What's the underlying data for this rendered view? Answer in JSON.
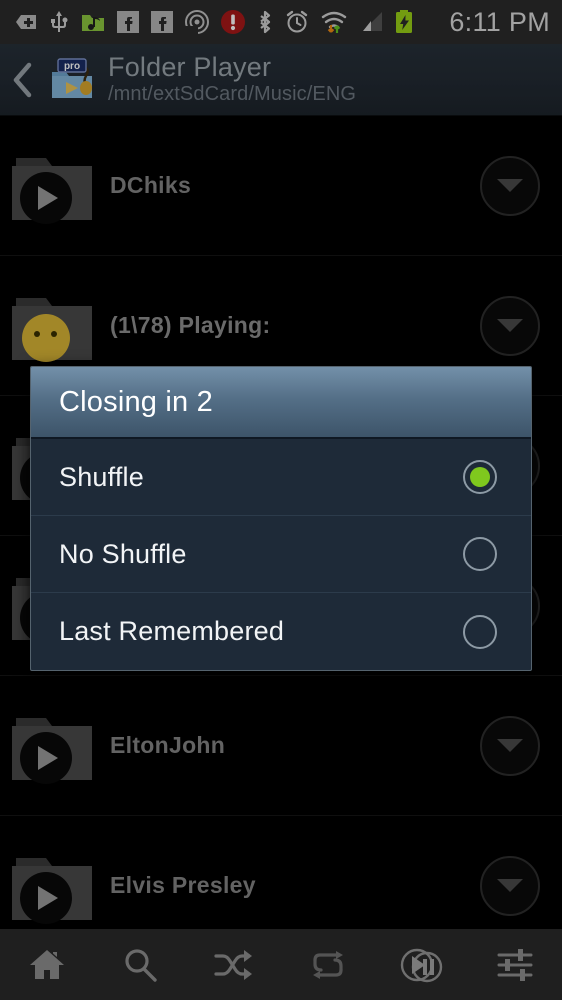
{
  "statusbar": {
    "time": "6:11 PM",
    "icons": [
      {
        "name": "download-tag-icon"
      },
      {
        "name": "usb-icon"
      },
      {
        "name": "music-folder-icon"
      },
      {
        "name": "facebook-icon"
      },
      {
        "name": "facebook-icon"
      },
      {
        "name": "nfc-icon"
      },
      {
        "name": "alert-icon"
      },
      {
        "name": "bluetooth-icon"
      },
      {
        "name": "alarm-icon"
      },
      {
        "name": "wifi-transfer-icon"
      },
      {
        "name": "signal-bars-icon"
      },
      {
        "name": "battery-charging-icon"
      }
    ]
  },
  "header": {
    "back_label": "‹",
    "title": "Folder Player",
    "path": "/mnt/extSdCard/Music/ENG",
    "badge": "pro"
  },
  "list": {
    "rows": [
      {
        "label": "DChiks",
        "icon": "folder-play-icon",
        "menu": "chevron-down-icon"
      },
      {
        "label": "(1\\78)  Playing:",
        "icon": "folder-playing-icon",
        "menu": "chevron-down-icon"
      },
      {
        "label": "",
        "icon": "folder-play-icon",
        "menu": "chevron-down-icon"
      },
      {
        "label": "",
        "icon": "folder-play-icon",
        "menu": "chevron-down-icon"
      },
      {
        "label": "EltonJohn",
        "icon": "folder-play-icon",
        "menu": "chevron-down-icon"
      },
      {
        "label": "Elvis Presley",
        "icon": "folder-play-icon",
        "menu": "chevron-down-icon"
      }
    ]
  },
  "dialog": {
    "title": "Closing in 2",
    "options": [
      {
        "label": "Shuffle",
        "selected": true
      },
      {
        "label": "No Shuffle",
        "selected": false
      },
      {
        "label": "Last Remembered",
        "selected": false
      }
    ]
  },
  "bottomnav": {
    "items": [
      {
        "name": "home-icon",
        "label": "Home"
      },
      {
        "name": "search-icon",
        "label": "Search"
      },
      {
        "name": "shuffle-icon",
        "label": "Shuffle"
      },
      {
        "name": "repeat-icon",
        "label": "Repeat"
      },
      {
        "name": "play-pause-icon",
        "label": "Play/Pause"
      },
      {
        "name": "equalizer-icon",
        "label": "Equalizer"
      }
    ]
  },
  "colors": {
    "accent_green": "#7fc81e",
    "dialog_bg": "#1e2a38",
    "dialog_header": "#546f87",
    "header_bg": "#222a33",
    "status_bg": "#2b2b2b"
  }
}
